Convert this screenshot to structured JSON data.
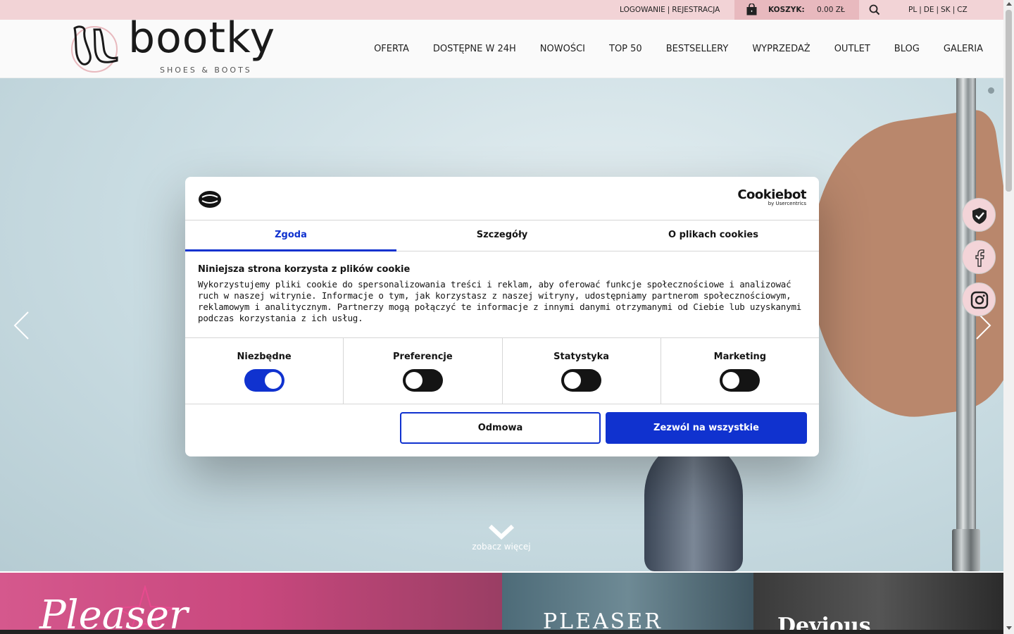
{
  "topbar": {
    "login": "LOGOWANIE",
    "separator": "|",
    "register": "REJESTRACJA",
    "cart_label": "KOSZYK:",
    "cart_amount": "0.00 ZŁ",
    "languages": [
      "PL",
      "DE",
      "SK",
      "CZ"
    ]
  },
  "header": {
    "logo_word": "bootky",
    "logo_sub": "SHOES & BOOTS",
    "nav": [
      "OFERTA",
      "DOSTĘPNE W 24H",
      "NOWOŚCI",
      "TOP 50",
      "BESTSELLERY",
      "WYPRZEDAŻ",
      "OUTLET",
      "BLOG",
      "GALERIA"
    ]
  },
  "hero": {
    "see_more": "zobacz więcej"
  },
  "cookie": {
    "brand": "Cookiebot",
    "brand_sub": "by Usercentrics",
    "tabs": [
      "Zgoda",
      "Szczegóły",
      "O plikach cookies"
    ],
    "active_tab": "Zgoda",
    "title": "Niniejsza strona korzysta z plików cookie",
    "body": "Wykorzystujemy pliki cookie do spersonalizowania treści i reklam, aby oferować funkcje społecznościowe i analizować ruch w naszej witrynie. Informacje o tym, jak korzystasz z naszej witryny, udostępniamy partnerom społecznościowym, reklamowym i analitycznym. Partnerzy mogą połączyć te informacje z innymi danymi otrzymanymi od Ciebie lub uzyskanymi podczas korzystania z ich usług.",
    "categories": [
      {
        "label": "Niezbędne",
        "on": true
      },
      {
        "label": "Preferencje",
        "on": false
      },
      {
        "label": "Statystyka",
        "on": false
      },
      {
        "label": "Marketing",
        "on": false
      }
    ],
    "decline": "Odmowa",
    "allow_all": "Zezwól na wszystkie",
    "accent": "#1032cf"
  },
  "brands": [
    "Pleaser",
    "PLEASER",
    "Devious"
  ],
  "social": [
    "shield-check-icon",
    "facebook-icon",
    "instagram-icon"
  ],
  "colors": {
    "topbar": "#f2d3d6",
    "cart": "#e8b9be"
  }
}
